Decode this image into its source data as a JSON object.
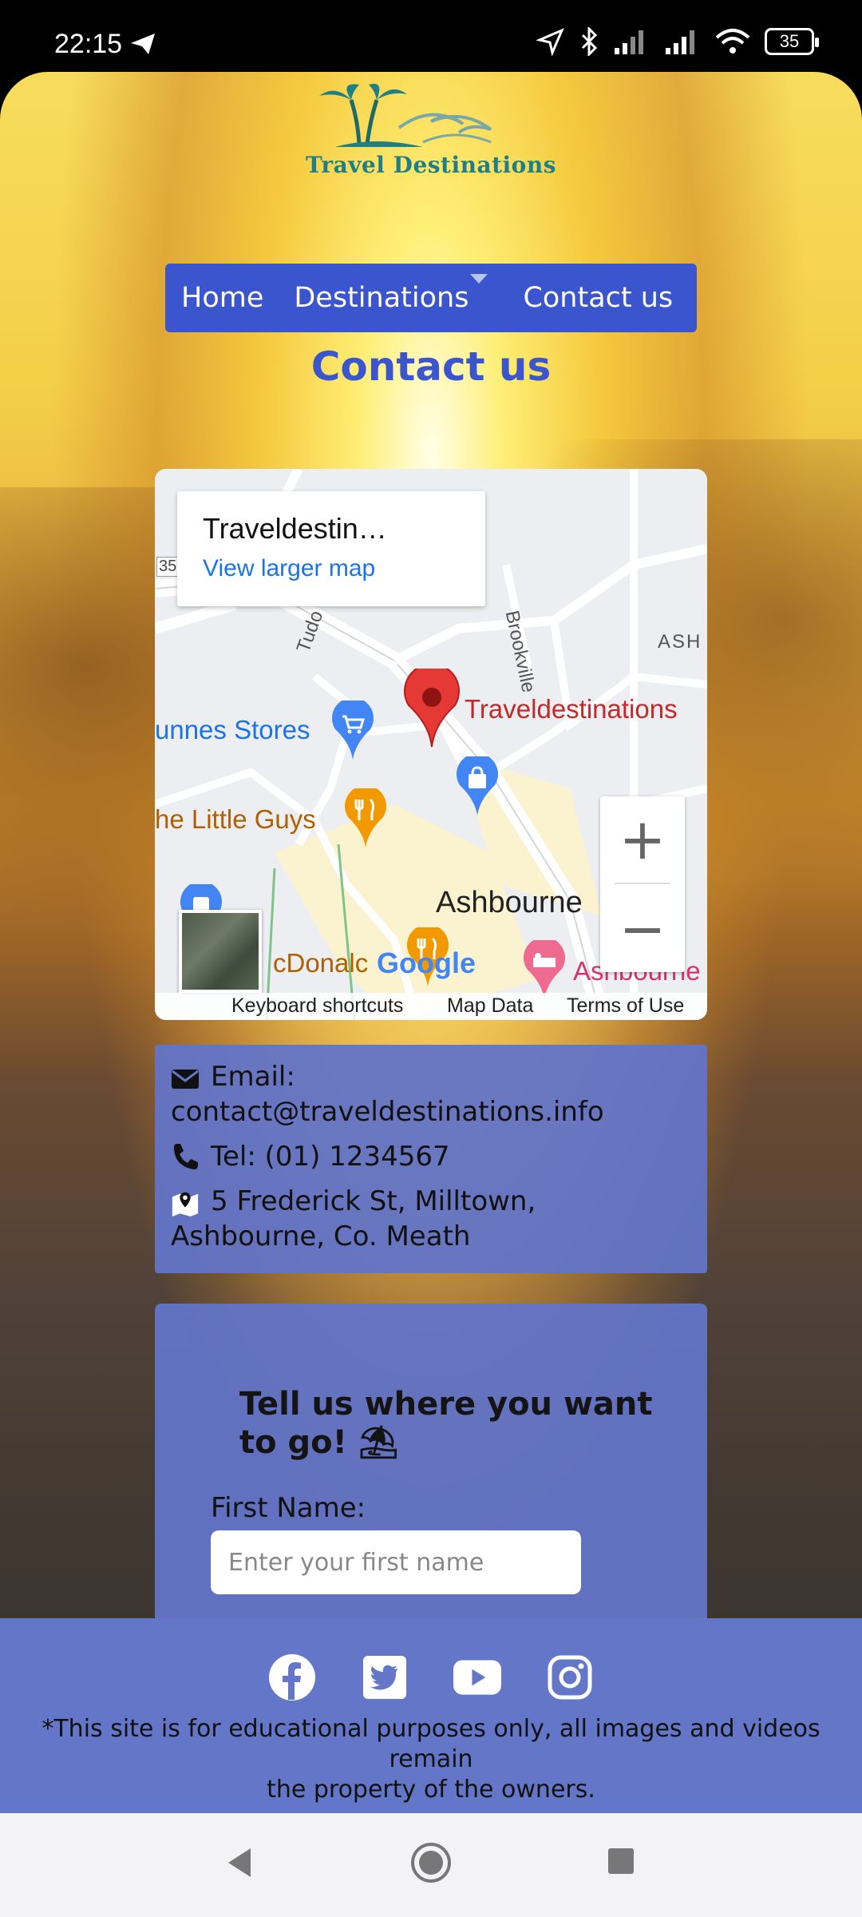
{
  "status_bar": {
    "time": "22:15",
    "battery": "35"
  },
  "logo": {
    "text": "Travel Destinations"
  },
  "nav": {
    "home": "Home",
    "destinations": "Destinations",
    "contact": "Contact us"
  },
  "page_title": "Contact us",
  "map": {
    "place_name": "Traveldestin…",
    "larger_map_link": "View larger map",
    "pin_label": "Traveldestinations",
    "labels": {
      "dunnes": "unnes Stores",
      "little_guys": "he Little Guys",
      "ashbourne": "Ashbourne",
      "mcdonalds": "cDonalc",
      "ashbourne_hotel": "Ashbourne",
      "brookville": "Brookville",
      "tudor": "Tudo",
      "ash": "ASH",
      "num": "35",
      "google": "Google"
    },
    "footer": {
      "shortcuts": "Keyboard shortcuts",
      "map_data": "Map Data",
      "terms": "Terms of Use"
    }
  },
  "contact": {
    "email_label": "Email:",
    "email": "contact@traveldestinations.info",
    "tel": "Tel: (01) 1234567",
    "address_line1": "5 Frederick St, Milltown,",
    "address_line2": "Ashbourne, Co. Meath"
  },
  "form": {
    "heading": "Tell us where you want to go! ⛱",
    "first_name_label": "First Name:",
    "first_name_placeholder": "Enter your first name"
  },
  "footer": {
    "disclaimer_line1": "*This site is for educational purposes only, all images and videos remain",
    "disclaimer_line2": "the property of the owners."
  }
}
